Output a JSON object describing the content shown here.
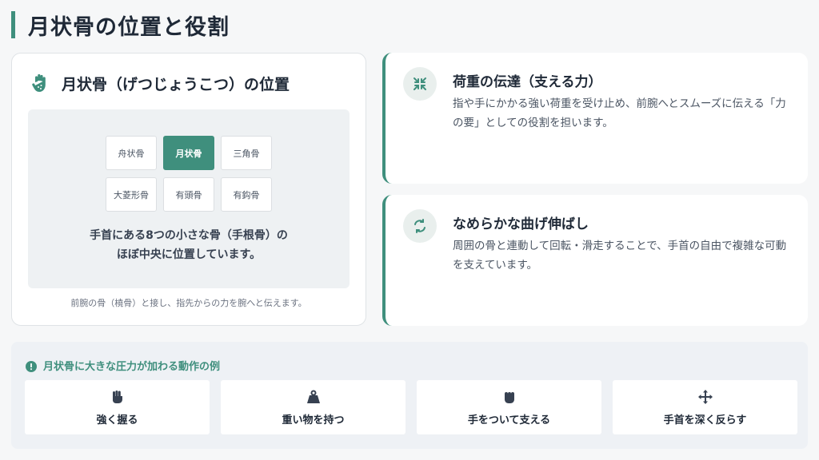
{
  "page": {
    "title": "月状骨の位置と役割"
  },
  "colors": {
    "accent": "#3f8f7d",
    "panel": "#eef1f3"
  },
  "position_card": {
    "icon": "hand-icon",
    "title": "月状骨（げつじょうこつ）の位置",
    "bones": [
      {
        "label": "舟状骨",
        "active": false
      },
      {
        "label": "月状骨",
        "active": true
      },
      {
        "label": "三角骨",
        "active": false
      },
      {
        "label": "大菱形骨",
        "active": false
      },
      {
        "label": "有頭骨",
        "active": false
      },
      {
        "label": "有鈎骨",
        "active": false
      }
    ],
    "caption_line1": "手首にある8つの小さな骨（手根骨）の",
    "caption_line2": "ほぼ中央に位置しています。",
    "note": "前腕の骨（橈骨）と接し、指先からの力を腕へと伝えます。"
  },
  "roles": [
    {
      "icon": "compress-icon",
      "title": "荷重の伝達（支える力）",
      "text": "指や手にかかる強い荷重を受け止め、前腕へとスムーズに伝える「力の要」としての役割を担います。"
    },
    {
      "icon": "rotate-icon",
      "title": "なめらかな曲げ伸ばし",
      "text": "周囲の骨と連動して回転・滑走することで、手首の自由で複雑な可動を支えています。"
    }
  ],
  "examples": {
    "icon": "alert-icon",
    "title": "月状骨に大きな圧力が加わる動作の例",
    "items": [
      {
        "icon": "fist-icon",
        "label": "強く握る"
      },
      {
        "icon": "weight-icon",
        "label": "重い物を持つ"
      },
      {
        "icon": "hand-rock-icon",
        "label": "手をついて支える"
      },
      {
        "icon": "arrows-move-icon",
        "label": "手首を深く反らす"
      }
    ]
  }
}
